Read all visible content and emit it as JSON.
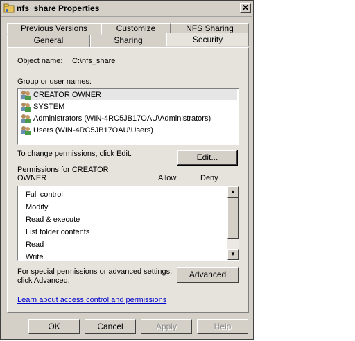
{
  "window": {
    "title": "nfs_share Properties",
    "close_glyph": "✕"
  },
  "tabs_back": [
    "Previous Versions",
    "Customize",
    "NFS Sharing"
  ],
  "tabs_front": [
    "General",
    "Sharing",
    "Security"
  ],
  "active_tab": "Security",
  "object": {
    "label": "Object name:",
    "value": "C:\\nfs_share"
  },
  "groups": {
    "label": "Group or user names:",
    "items": [
      {
        "name": "CREATOR OWNER",
        "selected": true
      },
      {
        "name": "SYSTEM",
        "selected": false
      },
      {
        "name": "Administrators (WIN-4RC5JB17OAU\\Administrators)",
        "selected": false
      },
      {
        "name": "Users (WIN-4RC5JB17OAU\\Users)",
        "selected": false
      }
    ]
  },
  "edit_hint": "To change permissions, click Edit.",
  "edit_button": "Edit...",
  "permissions": {
    "label_line1": "Permissions for CREATOR",
    "label_line2": "OWNER",
    "allow_header": "Allow",
    "deny_header": "Deny",
    "items": [
      "Full control",
      "Modify",
      "Read & execute",
      "List folder contents",
      "Read",
      "Write"
    ]
  },
  "advanced_hint_line1": "For special permissions or advanced settings,",
  "advanced_hint_line2": "click Advanced.",
  "advanced_button": "Advanced",
  "learn_link": "Learn about access control and permissions",
  "buttons": {
    "ok": "OK",
    "cancel": "Cancel",
    "apply": "Apply",
    "help": "Help"
  },
  "icons": {
    "title": "folder-share-icon",
    "user": "user-group-icon",
    "scroll_up": "▲",
    "scroll_down": "▼"
  }
}
